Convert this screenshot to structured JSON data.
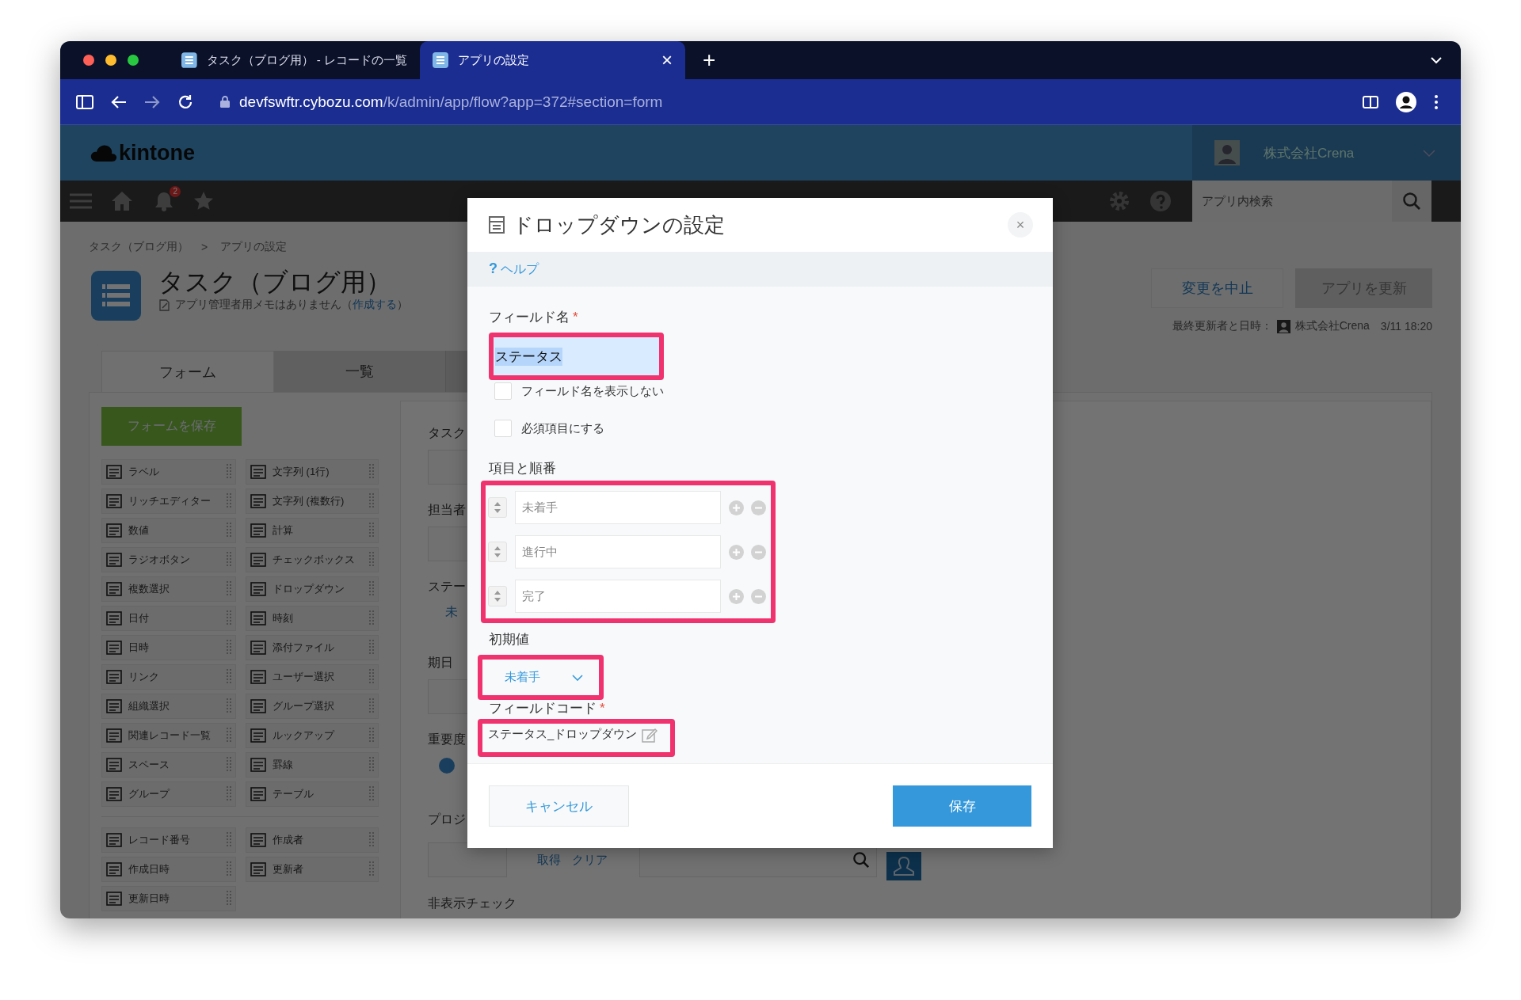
{
  "browser": {
    "tabs": [
      {
        "title": "タスク（ブログ用） - レコードの一覧",
        "selected": false
      },
      {
        "title": "アプリの設定",
        "selected": true
      }
    ],
    "tab_close": "×",
    "new_tab": "+",
    "url": {
      "host": "devfswftr.cybozu.com",
      "path": "/k/admin/app/flow?app=372#section=form"
    }
  },
  "header": {
    "logo": "kintone",
    "user": "株式会社Crena"
  },
  "nav": {
    "notification_count": "2",
    "search_placeholder": "アプリ内検索"
  },
  "breadcrumb": {
    "items": [
      "タスク（ブログ用）",
      "アプリの設定"
    ],
    "separator": ">"
  },
  "app": {
    "title": "タスク（ブログ用）",
    "memo": "アプリ管理者用メモはありません（",
    "memo_link": "作成する",
    "memo_end": "）"
  },
  "actions": {
    "cancel": "変更を中止",
    "update": "アプリを更新",
    "last_updated_label": "最終更新者と日時：",
    "last_updated_user": "株式会社Crena",
    "last_updated_time": "3/11 18:20"
  },
  "settings_tabs": [
    {
      "label": "フォーム",
      "selected": true
    },
    {
      "label": "一覧",
      "selected": false
    }
  ],
  "palette": {
    "save_button": "フォームを保存",
    "fields": [
      "ラベル",
      "文字列 (1行)",
      "リッチエディター",
      "文字列 (複数行)",
      "数値",
      "計算",
      "ラジオボタン",
      "チェックボックス",
      "複数選択",
      "ドロップダウン",
      "日付",
      "時刻",
      "日時",
      "添付ファイル",
      "リンク",
      "ユーザー選択",
      "組織選択",
      "グループ選択",
      "関連レコード一覧",
      "ルックアップ",
      "スペース",
      "罫線",
      "グループ",
      "テーブル"
    ],
    "system_fields": [
      "レコード番号",
      "作成者",
      "作成日時",
      "更新者",
      "更新日時"
    ]
  },
  "form_preview": [
    {
      "label": "タスク",
      "kind": "text"
    },
    {
      "label": "担当者",
      "kind": "text"
    },
    {
      "label": "ステー",
      "kind": "value",
      "value": "未"
    },
    {
      "label": "期日",
      "kind": "text"
    },
    {
      "label": "重要度",
      "kind": "radio",
      "selected": true
    },
    {
      "label": "プロジ",
      "kind": "lookup",
      "links": [
        "取得",
        "クリア"
      ]
    },
    {
      "label": "非表示チェック",
      "kind": "label"
    }
  ],
  "dialog": {
    "title": "ドロップダウンの設定",
    "close": "×",
    "help_icon": "?",
    "help": "ヘルプ",
    "field_name": {
      "label": "フィールド名",
      "required_mark": "*",
      "value": "ステータス",
      "highlighted": true
    },
    "options": [
      {
        "label": "フィールド名を表示しない",
        "checked": false
      },
      {
        "label": "必須項目にする",
        "checked": false
      }
    ],
    "choices": {
      "label": "項目と順番",
      "items": [
        "未着手",
        "進行中",
        "完了"
      ],
      "highlighted": true
    },
    "default": {
      "label": "初期値",
      "value": "未着手",
      "highlighted": true
    },
    "field_code": {
      "label": "フィールドコード",
      "required_mark": "*",
      "value": "ステータス_ドロップダウン",
      "highlighted": true
    },
    "cancel": "キャンセル",
    "save": "保存"
  }
}
